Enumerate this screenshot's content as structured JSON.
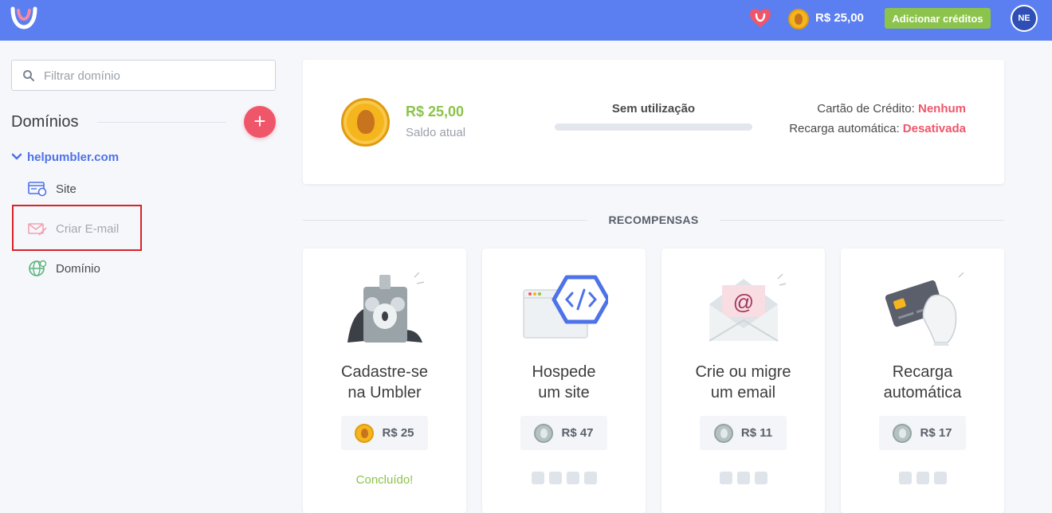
{
  "topbar": {
    "balance": "R$ 25,00",
    "add_credits_label": "Adicionar créditos",
    "avatar_initials": "NE"
  },
  "sidebar": {
    "filter_placeholder": "Filtrar domínio",
    "domains_title": "Domínios",
    "add_domain_symbol": "+",
    "domain": "helpumbler.com",
    "items": [
      {
        "label": "Site",
        "icon": "site-icon"
      },
      {
        "label": "Criar E-mail",
        "icon": "mail-icon"
      },
      {
        "label": "Domínio",
        "icon": "globe-icon"
      }
    ]
  },
  "balance_card": {
    "amount": "R$ 25,00",
    "label": "Saldo atual",
    "usage_label": "Sem utilização",
    "usage_fraction": 0,
    "credit_card_label": "Cartão de Crédito:",
    "credit_card_value": "Nenhum",
    "auto_recharge_label": "Recarga automática:",
    "auto_recharge_value": "Desativada"
  },
  "rewards": {
    "title": "RECOMPENSAS",
    "items": [
      {
        "title_line1": "Cadastre-se",
        "title_line2": "na Umbler",
        "value": "R$ 25",
        "status": "Concluído!",
        "coin": "gold"
      },
      {
        "title_line1": "Hospede",
        "title_line2": "um site",
        "value": "R$ 47",
        "steps": 4,
        "coin": "grey"
      },
      {
        "title_line1": "Crie ou migre",
        "title_line2": "um email",
        "value": "R$ 11",
        "steps": 3,
        "coin": "grey"
      },
      {
        "title_line1": "Recarga",
        "title_line2": "automática",
        "value": "R$ 17",
        "steps": 3,
        "coin": "grey"
      }
    ]
  },
  "colors": {
    "topbar": "#5b7ff0",
    "accent_green": "#8cc34b",
    "accent_red": "#f0566a",
    "link_blue": "#4e72e8",
    "highlight_box": "#d8232a"
  }
}
